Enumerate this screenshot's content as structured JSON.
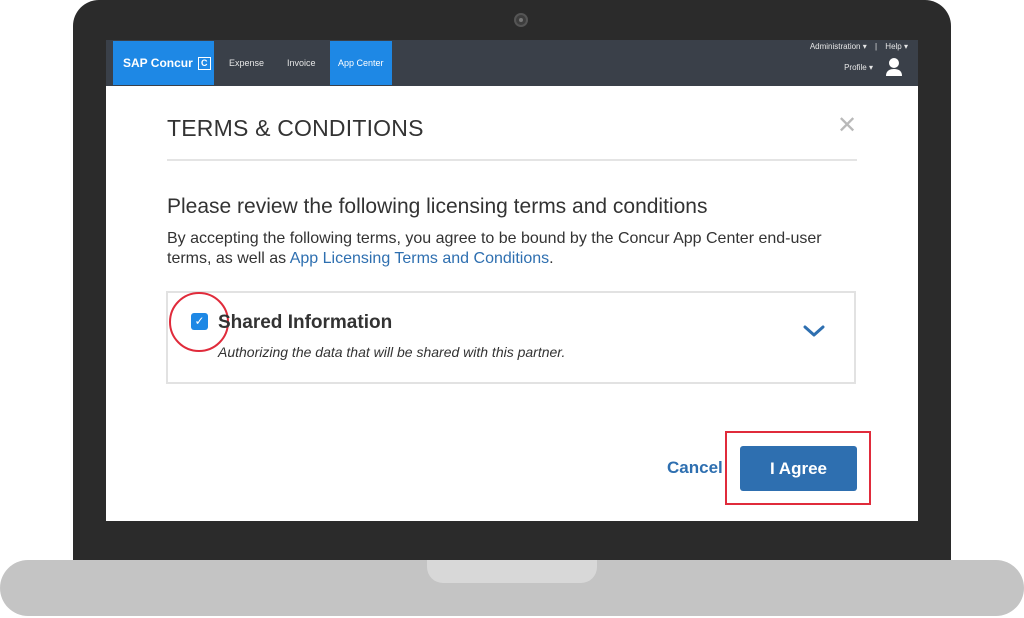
{
  "nav": {
    "brand": "SAP Concur",
    "brand_mark": "C",
    "links": [
      "Expense",
      "Invoice",
      "App Center"
    ],
    "active_link": "App Center",
    "admin": "Administration ▾",
    "separator": "|",
    "help": "Help ▾",
    "profile": "Profile ▾"
  },
  "modal": {
    "title": "TERMS & CONDITIONS",
    "close": "✕",
    "heading": "Please review the following licensing terms and conditions",
    "paragraph_prefix": "By accepting the following terms, you agree to be bound by the Concur App Center end-user terms, as well as ",
    "link_text": "App Licensing Terms and Conditions",
    "paragraph_suffix": ".",
    "shared": {
      "checked": true,
      "check_glyph": "✓",
      "title": "Shared Information",
      "description": "Authorizing the data that will be shared with this partner."
    },
    "cancel_label": "Cancel",
    "agree_label": "I Agree"
  },
  "colors": {
    "accent": "#1e88e5",
    "button": "#2e6fb0",
    "annotation": "#e02b3b",
    "nav_bg": "#3a4049"
  },
  "icons": [
    "camera-icon",
    "user-icon",
    "close-icon",
    "checkbox-icon",
    "chevron-down-icon"
  ]
}
